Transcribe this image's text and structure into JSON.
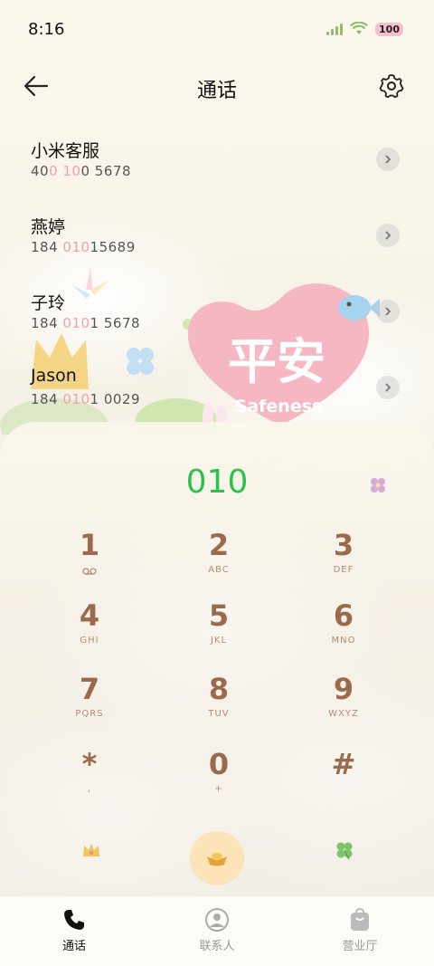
{
  "status_bar": {
    "time": "8:16",
    "battery": "100"
  },
  "header": {
    "title": "通话"
  },
  "contacts": [
    {
      "name": "小米客服",
      "number_pre": "40",
      "number_hl": "0 10",
      "number_post": "0 5678"
    },
    {
      "name": "燕婷",
      "number_pre": "184 ",
      "number_hl": "010",
      "number_post": "15689"
    },
    {
      "name": "子玲",
      "number_pre": "184 ",
      "number_hl": "010",
      "number_post": "1 5678"
    },
    {
      "name": "Jason",
      "number_pre": "184 ",
      "number_hl": "010",
      "number_post": "1 0029"
    }
  ],
  "decoration": {
    "heart_title": "平安",
    "heart_subtitle": "Safeness"
  },
  "dialpad": {
    "input": "010",
    "keys": [
      {
        "digit": "1",
        "letters": ""
      },
      {
        "digit": "2",
        "letters": "ABC"
      },
      {
        "digit": "3",
        "letters": "DEF"
      },
      {
        "digit": "4",
        "letters": "GHI"
      },
      {
        "digit": "5",
        "letters": "JKL"
      },
      {
        "digit": "6",
        "letters": "MNO"
      },
      {
        "digit": "7",
        "letters": "PQRS"
      },
      {
        "digit": "8",
        "letters": "TUV"
      },
      {
        "digit": "9",
        "letters": "WXYZ"
      },
      {
        "digit": "*",
        "letters": ","
      },
      {
        "digit": "0",
        "letters": "+"
      },
      {
        "digit": "#",
        "letters": ""
      }
    ]
  },
  "bottom_nav": [
    {
      "label": "通话",
      "icon": "phone-icon",
      "active": true
    },
    {
      "label": "联系人",
      "icon": "person-icon",
      "active": false
    },
    {
      "label": "营业厅",
      "icon": "shopping-bag-icon",
      "active": false
    }
  ],
  "colors": {
    "accent_green": "#2ec24c",
    "key_brown": "#9b6a4d",
    "highlight_pink": "#f2a0ab",
    "call_button": "#fde3b8"
  }
}
